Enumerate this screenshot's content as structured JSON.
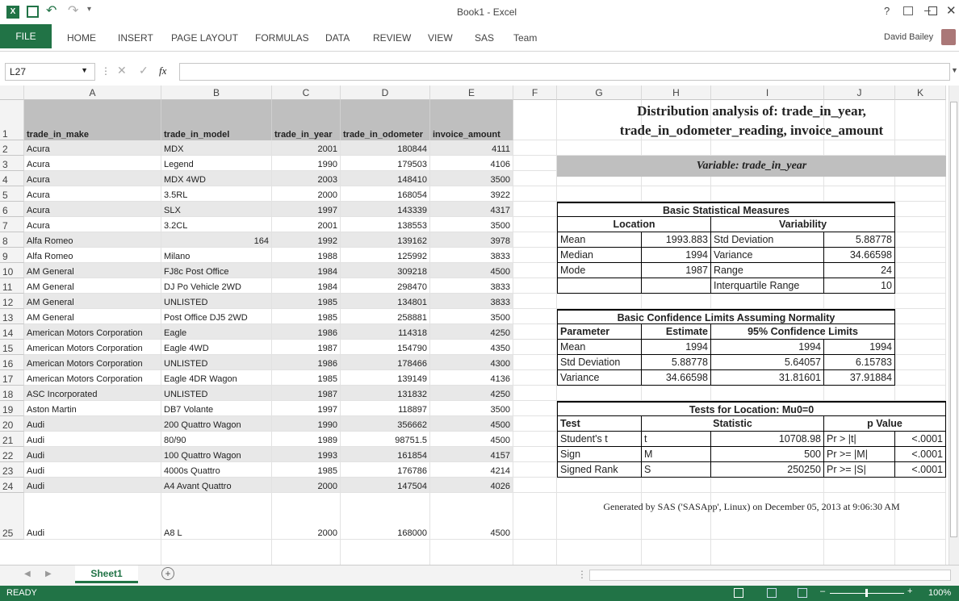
{
  "window": {
    "title": "Book1 - Excel",
    "user": "David Bailey",
    "help": "?"
  },
  "ribbon": {
    "file": "FILE",
    "tabs": [
      "HOME",
      "INSERT",
      "PAGE LAYOUT",
      "FORMULAS",
      "DATA",
      "REVIEW",
      "VIEW",
      "SAS",
      "Team"
    ]
  },
  "formula_bar": {
    "name_box": "L27",
    "fx": "fx",
    "value": ""
  },
  "columns": [
    "A",
    "B",
    "C",
    "D",
    "E",
    "F",
    "G",
    "H",
    "I",
    "J",
    "K"
  ],
  "headers": [
    "trade_in_make",
    "trade_in_model",
    "trade_in_year",
    "trade_in_odometer",
    "invoice_amount"
  ],
  "rows": [
    [
      "Acura",
      "MDX",
      "2001",
      "180844",
      "4111"
    ],
    [
      "Acura",
      "Legend",
      "1990",
      "179503",
      "4106"
    ],
    [
      "Acura",
      "MDX 4WD",
      "2003",
      "148410",
      "3500"
    ],
    [
      "Acura",
      "3.5RL",
      "2000",
      "168054",
      "3922"
    ],
    [
      "Acura",
      "SLX",
      "1997",
      "143339",
      "4317"
    ],
    [
      "Acura",
      "3.2CL",
      "2001",
      "138553",
      "3500"
    ],
    [
      "Alfa Romeo",
      "164",
      "1992",
      "139162",
      "3978"
    ],
    [
      "Alfa Romeo",
      "Milano",
      "1988",
      "125992",
      "3833"
    ],
    [
      "AM General",
      "FJ8c Post Office",
      "1984",
      "309218",
      "4500"
    ],
    [
      "AM General",
      "DJ Po Vehicle 2WD",
      "1984",
      "298470",
      "3833"
    ],
    [
      "AM General",
      "UNLISTED",
      "1985",
      "134801",
      "3833"
    ],
    [
      "AM General",
      "Post Office DJ5 2WD",
      "1985",
      "258881",
      "3500"
    ],
    [
      "American Motors Corporation",
      "Eagle",
      "1986",
      "114318",
      "4250"
    ],
    [
      "American Motors Corporation",
      "Eagle 4WD",
      "1987",
      "154790",
      "4350"
    ],
    [
      "American Motors Corporation",
      "UNLISTED",
      "1986",
      "178466",
      "4300"
    ],
    [
      "American Motors Corporation",
      "Eagle 4DR Wagon",
      "1985",
      "139149",
      "4136"
    ],
    [
      "ASC Incorporated",
      "UNLISTED",
      "1987",
      "131832",
      "4250"
    ],
    [
      "Aston Martin",
      "DB7 Volante",
      "1997",
      "118897",
      "3500"
    ],
    [
      "Audi",
      "200 Quattro Wagon",
      "1990",
      "356662",
      "4500"
    ],
    [
      "Audi",
      "80/90",
      "1989",
      "98751.5",
      "4500"
    ],
    [
      "Audi",
      "100 Quattro Wagon",
      "1993",
      "161854",
      "4157"
    ],
    [
      "Audi",
      "4000s Quattro",
      "1985",
      "176786",
      "4214"
    ],
    [
      "Audi",
      "A4 Avant Quattro",
      "2000",
      "147504",
      "4026"
    ],
    [
      "Audi",
      "A8 L",
      "2000",
      "168000",
      "4500"
    ]
  ],
  "report": {
    "title_line1": "Distribution analysis of: trade_in_year,",
    "title_line2": "trade_in_odometer_reading, invoice_amount",
    "variable": "Variable:  trade_in_year",
    "basic": {
      "title": "Basic Statistical Measures",
      "location": "Location",
      "variability": "Variability",
      "rows": [
        [
          "Mean",
          "1993.883",
          "Std Deviation",
          "5.88778"
        ],
        [
          "Median",
          "1994",
          "Variance",
          "34.66598"
        ],
        [
          "Mode",
          "1987",
          "Range",
          "24"
        ],
        [
          "",
          "",
          "Interquartile Range",
          "10"
        ]
      ]
    },
    "conf": {
      "title": "Basic Confidence Limits Assuming Normality",
      "h": [
        "Parameter",
        "Estimate",
        "95% Confidence Limits"
      ],
      "rows": [
        [
          "Mean",
          "1994",
          "1994",
          "1994"
        ],
        [
          "Std Deviation",
          "5.88778",
          "5.64057",
          "6.15783"
        ],
        [
          "Variance",
          "34.66598",
          "31.81601",
          "37.91884"
        ]
      ]
    },
    "tests": {
      "title": "Tests for Location: Mu0=0",
      "h": [
        "Test",
        "Statistic",
        "p Value"
      ],
      "rows": [
        [
          "Student's t",
          "t",
          "10708.98",
          "Pr > |t|",
          "<.0001"
        ],
        [
          "Sign",
          "M",
          "500",
          "Pr >= |M|",
          "<.0001"
        ],
        [
          "Signed Rank",
          "S",
          "250250",
          "Pr >= |S|",
          "<.0001"
        ]
      ]
    },
    "footer": "Generated by SAS ('SASApp', Linux) on December 05, 2013 at 9:06:30 AM"
  },
  "sheet": {
    "tab": "Sheet1"
  },
  "status": {
    "mode": "READY",
    "zoom": "100%"
  }
}
